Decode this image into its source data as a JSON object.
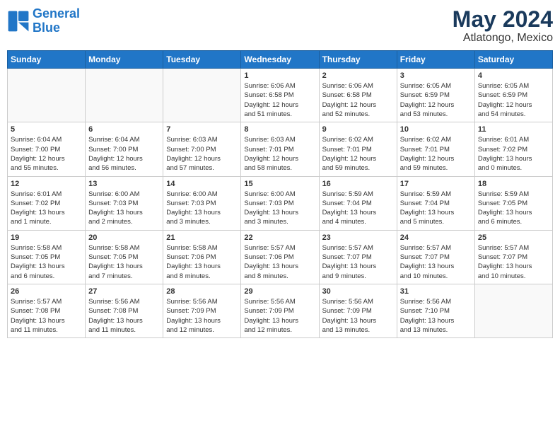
{
  "header": {
    "logo_line1": "General",
    "logo_line2": "Blue",
    "title": "May 2024",
    "subtitle": "Atlatongo, Mexico"
  },
  "days_of_week": [
    "Sunday",
    "Monday",
    "Tuesday",
    "Wednesday",
    "Thursday",
    "Friday",
    "Saturday"
  ],
  "weeks": [
    [
      {
        "day": "",
        "info": "",
        "empty": true
      },
      {
        "day": "",
        "info": "",
        "empty": true
      },
      {
        "day": "",
        "info": "",
        "empty": true
      },
      {
        "day": "1",
        "info": "Sunrise: 6:06 AM\nSunset: 6:58 PM\nDaylight: 12 hours\nand 51 minutes."
      },
      {
        "day": "2",
        "info": "Sunrise: 6:06 AM\nSunset: 6:58 PM\nDaylight: 12 hours\nand 52 minutes."
      },
      {
        "day": "3",
        "info": "Sunrise: 6:05 AM\nSunset: 6:59 PM\nDaylight: 12 hours\nand 53 minutes."
      },
      {
        "day": "4",
        "info": "Sunrise: 6:05 AM\nSunset: 6:59 PM\nDaylight: 12 hours\nand 54 minutes."
      }
    ],
    [
      {
        "day": "5",
        "info": "Sunrise: 6:04 AM\nSunset: 7:00 PM\nDaylight: 12 hours\nand 55 minutes."
      },
      {
        "day": "6",
        "info": "Sunrise: 6:04 AM\nSunset: 7:00 PM\nDaylight: 12 hours\nand 56 minutes."
      },
      {
        "day": "7",
        "info": "Sunrise: 6:03 AM\nSunset: 7:00 PM\nDaylight: 12 hours\nand 57 minutes."
      },
      {
        "day": "8",
        "info": "Sunrise: 6:03 AM\nSunset: 7:01 PM\nDaylight: 12 hours\nand 58 minutes."
      },
      {
        "day": "9",
        "info": "Sunrise: 6:02 AM\nSunset: 7:01 PM\nDaylight: 12 hours\nand 59 minutes."
      },
      {
        "day": "10",
        "info": "Sunrise: 6:02 AM\nSunset: 7:01 PM\nDaylight: 12 hours\nand 59 minutes."
      },
      {
        "day": "11",
        "info": "Sunrise: 6:01 AM\nSunset: 7:02 PM\nDaylight: 13 hours\nand 0 minutes."
      }
    ],
    [
      {
        "day": "12",
        "info": "Sunrise: 6:01 AM\nSunset: 7:02 PM\nDaylight: 13 hours\nand 1 minute."
      },
      {
        "day": "13",
        "info": "Sunrise: 6:00 AM\nSunset: 7:03 PM\nDaylight: 13 hours\nand 2 minutes."
      },
      {
        "day": "14",
        "info": "Sunrise: 6:00 AM\nSunset: 7:03 PM\nDaylight: 13 hours\nand 3 minutes."
      },
      {
        "day": "15",
        "info": "Sunrise: 6:00 AM\nSunset: 7:03 PM\nDaylight: 13 hours\nand 3 minutes."
      },
      {
        "day": "16",
        "info": "Sunrise: 5:59 AM\nSunset: 7:04 PM\nDaylight: 13 hours\nand 4 minutes."
      },
      {
        "day": "17",
        "info": "Sunrise: 5:59 AM\nSunset: 7:04 PM\nDaylight: 13 hours\nand 5 minutes."
      },
      {
        "day": "18",
        "info": "Sunrise: 5:59 AM\nSunset: 7:05 PM\nDaylight: 13 hours\nand 6 minutes."
      }
    ],
    [
      {
        "day": "19",
        "info": "Sunrise: 5:58 AM\nSunset: 7:05 PM\nDaylight: 13 hours\nand 6 minutes."
      },
      {
        "day": "20",
        "info": "Sunrise: 5:58 AM\nSunset: 7:05 PM\nDaylight: 13 hours\nand 7 minutes."
      },
      {
        "day": "21",
        "info": "Sunrise: 5:58 AM\nSunset: 7:06 PM\nDaylight: 13 hours\nand 8 minutes."
      },
      {
        "day": "22",
        "info": "Sunrise: 5:57 AM\nSunset: 7:06 PM\nDaylight: 13 hours\nand 8 minutes."
      },
      {
        "day": "23",
        "info": "Sunrise: 5:57 AM\nSunset: 7:07 PM\nDaylight: 13 hours\nand 9 minutes."
      },
      {
        "day": "24",
        "info": "Sunrise: 5:57 AM\nSunset: 7:07 PM\nDaylight: 13 hours\nand 10 minutes."
      },
      {
        "day": "25",
        "info": "Sunrise: 5:57 AM\nSunset: 7:07 PM\nDaylight: 13 hours\nand 10 minutes."
      }
    ],
    [
      {
        "day": "26",
        "info": "Sunrise: 5:57 AM\nSunset: 7:08 PM\nDaylight: 13 hours\nand 11 minutes."
      },
      {
        "day": "27",
        "info": "Sunrise: 5:56 AM\nSunset: 7:08 PM\nDaylight: 13 hours\nand 11 minutes."
      },
      {
        "day": "28",
        "info": "Sunrise: 5:56 AM\nSunset: 7:09 PM\nDaylight: 13 hours\nand 12 minutes."
      },
      {
        "day": "29",
        "info": "Sunrise: 5:56 AM\nSunset: 7:09 PM\nDaylight: 13 hours\nand 12 minutes."
      },
      {
        "day": "30",
        "info": "Sunrise: 5:56 AM\nSunset: 7:09 PM\nDaylight: 13 hours\nand 13 minutes."
      },
      {
        "day": "31",
        "info": "Sunrise: 5:56 AM\nSunset: 7:10 PM\nDaylight: 13 hours\nand 13 minutes."
      },
      {
        "day": "",
        "info": "",
        "empty": true
      }
    ]
  ]
}
